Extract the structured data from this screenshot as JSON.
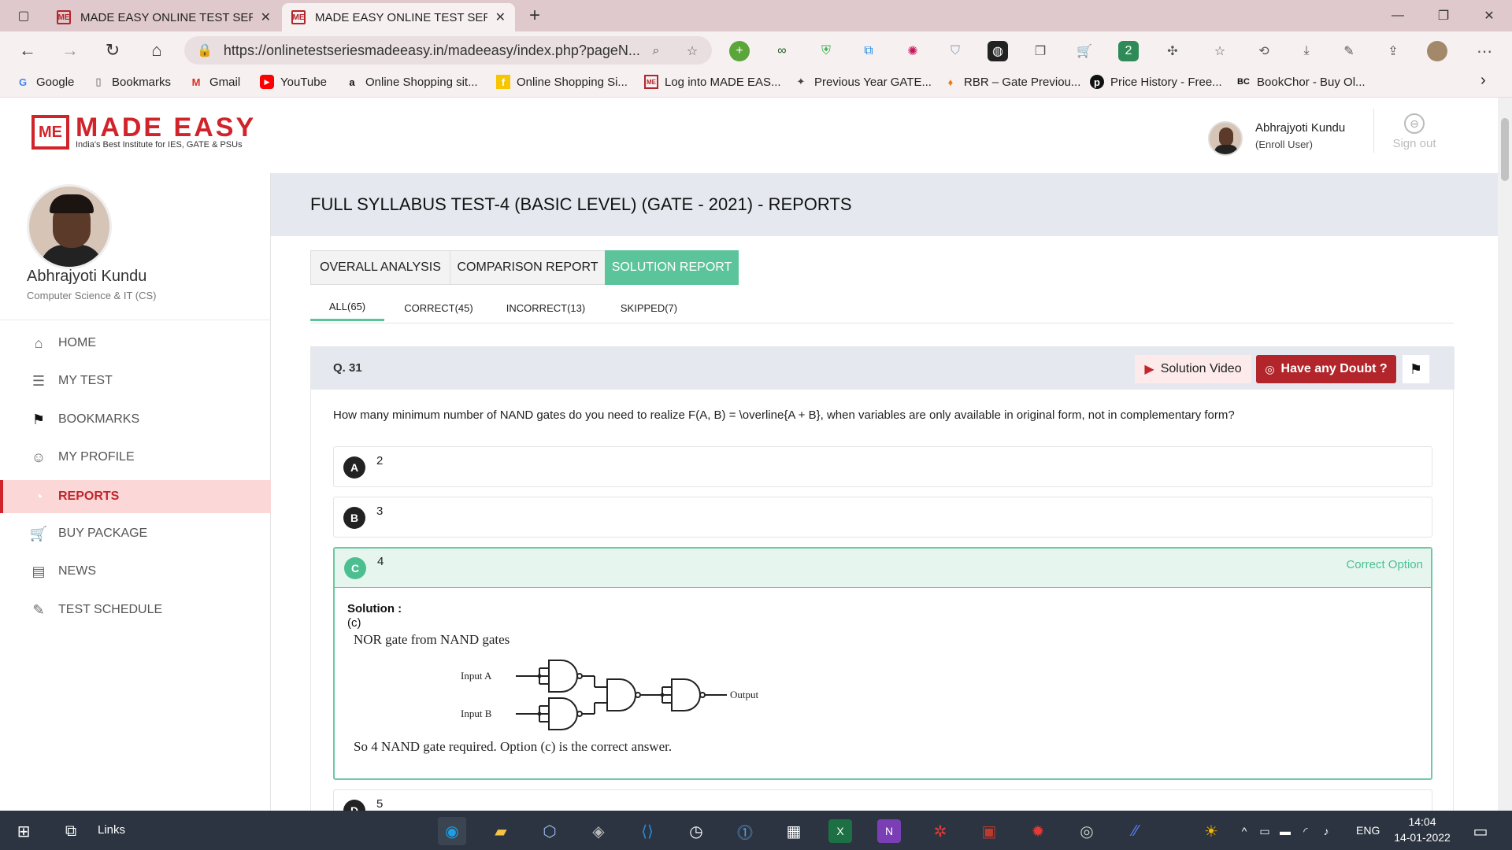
{
  "browser": {
    "tabs": [
      {
        "title": "MADE EASY ONLINE TEST SERIES",
        "active": false
      },
      {
        "title": "MADE EASY ONLINE TEST SERIES",
        "active": true
      }
    ],
    "new_tab": "+",
    "window_controls": {
      "minimize": "—",
      "restore": "❐",
      "close": "✕"
    },
    "url": "https://onlinetestseriesmadeeasy.in/madeeasy/index.php?pageN...",
    "bookmarks": [
      {
        "label": "Google",
        "icon": "google-icon",
        "color": "#4285f4"
      },
      {
        "label": "Bookmarks",
        "icon": "file-icon",
        "color": "#555555"
      },
      {
        "label": "Gmail",
        "icon": "gmail-icon",
        "color": "#d93025"
      },
      {
        "label": "YouTube",
        "icon": "youtube-icon",
        "color": "#ff0000"
      },
      {
        "label": "Online Shopping sit...",
        "icon": "amazon-icon",
        "color": "#111111"
      },
      {
        "label": "Online Shopping Si...",
        "icon": "flipkart-icon",
        "color": "#f7c600"
      },
      {
        "label": "Log into MADE EAS...",
        "icon": "madeeasy-icon",
        "color": "#b2252b"
      },
      {
        "label": "Previous Year GATE...",
        "icon": "gate-icon",
        "color": "#444444"
      },
      {
        "label": "RBR – Gate Previou...",
        "icon": "rbr-icon",
        "color": "#e67e22"
      },
      {
        "label": "Price History - Free...",
        "icon": "pricehistory-icon",
        "color": "#111111"
      },
      {
        "label": "BookChor - Buy Ol...",
        "icon": "bookchor-icon",
        "color": "#111111"
      }
    ],
    "bookmarks_more": "›"
  },
  "header": {
    "logo_mark": "ME",
    "logo_name": "MADE EASY",
    "logo_tagline": "India's Best Institute for IES, GATE & PSUs",
    "user_name": "Abhrajyoti Kundu",
    "user_role": "(Enroll User)",
    "sign_out": "Sign out"
  },
  "sidebar": {
    "name": "Abhrajyoti Kundu",
    "dept": "Computer Science & IT (CS)",
    "menu": [
      {
        "label": "HOME",
        "icon": "home-icon",
        "glyph": "⌂",
        "active": false
      },
      {
        "label": "MY TEST",
        "icon": "test-icon",
        "glyph": "☰",
        "active": false
      },
      {
        "label": "BOOKMARKS",
        "icon": "bookmark-icon",
        "glyph": "⚑",
        "active": false
      },
      {
        "label": "MY PROFILE",
        "icon": "profile-icon",
        "glyph": "☺",
        "active": false
      },
      {
        "label": "REPORTS",
        "icon": "reports-icon",
        "glyph": "◔",
        "active": true
      },
      {
        "label": "BUY PACKAGE",
        "icon": "cart-icon",
        "glyph": "🛒",
        "active": false
      },
      {
        "label": "NEWS",
        "icon": "news-icon",
        "glyph": "▤",
        "active": false
      },
      {
        "label": "TEST SCHEDULE",
        "icon": "schedule-icon",
        "glyph": "✎",
        "active": false
      }
    ]
  },
  "main": {
    "title": "FULL SYLLABUS TEST-4 (BASIC LEVEL) (GATE - 2021) - REPORTS",
    "report_tabs": [
      {
        "label": "OVERALL ANALYSIS",
        "active": false
      },
      {
        "label": "COMPARISON REPORT",
        "active": false
      },
      {
        "label": "SOLUTION REPORT",
        "active": true
      }
    ],
    "filter_tabs": [
      {
        "label": "ALL(65)",
        "active": true
      },
      {
        "label": "CORRECT(45)",
        "active": false
      },
      {
        "label": "INCORRECT(13)",
        "active": false
      },
      {
        "label": "SKIPPED(7)",
        "active": false
      }
    ],
    "question": {
      "number": "Q. 31",
      "solution_video": "Solution Video",
      "doubt": "Have any Doubt ?",
      "text": "How many minimum number of NAND gates do you need to realize F(A, B) = \\overline{A + B}, when variables are only available in original form, not in complementary form?",
      "options": [
        {
          "letter": "A",
          "value": "2"
        },
        {
          "letter": "B",
          "value": "3"
        },
        {
          "letter": "C",
          "value": "4"
        },
        {
          "letter": "D",
          "value": "5"
        }
      ],
      "correct_label": "Correct Option",
      "solution_label": "Solution :",
      "solution_answer": "(c)",
      "solution_heading": "NOR gate from NAND gates",
      "diagram": {
        "input_a": "Input A",
        "input_b": "Input B",
        "output": "Output"
      },
      "solution_conclusion": "So 4 NAND gate required. Option (c) is the correct answer."
    }
  },
  "taskbar": {
    "links": "Links",
    "lang": "ENG",
    "time": "14:04",
    "date": "14-01-2022",
    "colors": {
      "edge": "#1aa0e8",
      "excel": "#1d7044",
      "onenote": "#7b3fb5",
      "vscode": "#2a8ad4"
    }
  }
}
